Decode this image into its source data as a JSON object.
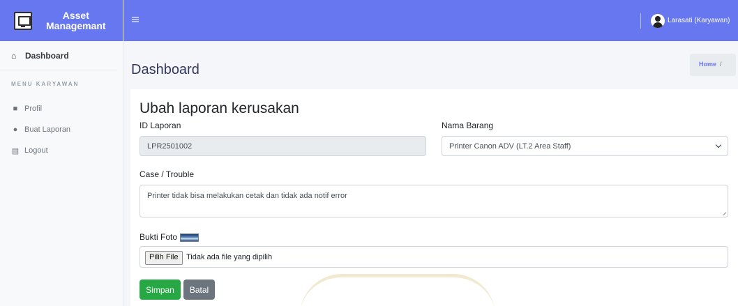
{
  "brand": {
    "title_line1": "Asset",
    "title_line2": "Managemant"
  },
  "sidebar": {
    "dashboard_label": "Dashboard",
    "section_header": "MENU KARYAWAN",
    "items": [
      {
        "label": "Profil",
        "icon": "user-icon"
      },
      {
        "label": "Buat Laporan",
        "icon": "exclamation-circle-icon"
      },
      {
        "label": "Logout",
        "icon": "chart-icon"
      }
    ]
  },
  "topbar": {
    "user_name": "Larasati (Karyawan)"
  },
  "page": {
    "title": "Dashboard",
    "breadcrumb_home": "Home",
    "breadcrumb_sep": "/"
  },
  "form": {
    "title": "Ubah laporan kerusakan",
    "id_label": "ID Laporan",
    "id_value": "LPR2501002",
    "item_label": "Nama Barang",
    "item_value": "Printer Canon ADV (LT.2 Area Staff)",
    "case_label": "Case / Trouble",
    "case_value": "Printer tidak bisa melakukan cetak dan tidak ada notif error",
    "photo_label": "Bukti Foto",
    "file_button": "Pilih File",
    "file_status": "Tidak ada file yang dipilih",
    "save_button": "Simpan",
    "cancel_button": "Batal"
  },
  "colors": {
    "primary": "#6777ef",
    "success": "#28a745",
    "secondary": "#6c757d"
  }
}
